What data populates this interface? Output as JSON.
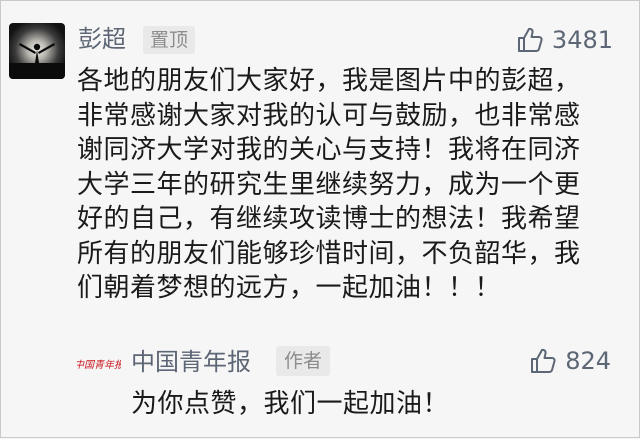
{
  "comment": {
    "author": "彭超",
    "badge": "置顶",
    "likes": "3481",
    "lines": [
      "各地的朋友们大家好，我是图片中的彭超，",
      "非常感谢大家对我的认可与鼓励，也非常感",
      "谢同济大学对我的关心与支持！我将在同济",
      "大学三年的研究生里继续努力，成为一个更",
      "好的自己，有继续攻读博士的想法！我希望",
      "所有的朋友们能够珍惜时间，不负韶华，我",
      "们朝着梦想的远方，一起加油！！！"
    ]
  },
  "reply": {
    "author": "中国青年报",
    "badge": "作者",
    "likes": "824",
    "text": "为你点赞，我们一起加油！",
    "logo_text": "中国青年报"
  },
  "colors": {
    "background": "#f6f6f6",
    "name": "#5d6675",
    "badge_bg": "#e9e9e9",
    "badge_text": "#8c8c8c",
    "body_text": "#1a1a1a",
    "logo_red": "#c8161d"
  },
  "icons": {
    "avatar": "person-arms-raised-sunset-avatar",
    "like": "thumbs-up-icon",
    "reply_logo": "newspaper-logo"
  }
}
